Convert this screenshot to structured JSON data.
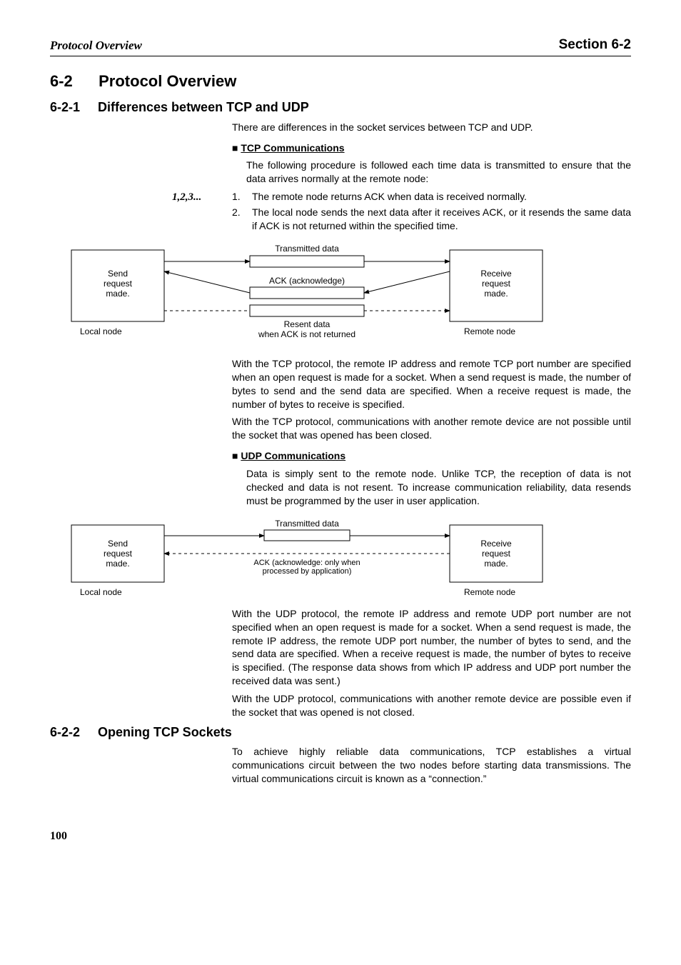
{
  "header": {
    "left": "Protocol Overview",
    "right": "Section 6-2"
  },
  "section": {
    "num": "6-2",
    "title": "Protocol Overview"
  },
  "sub1": {
    "num": "6-2-1",
    "title": "Differences between TCP and UDP",
    "intro": "There are differences in the socket services between TCP and UDP.",
    "tcp_h": "TCP Communications",
    "tcp_p1": "The following procedure is followed each time data is transmitted to ensure that the data arrives normally at the remote node:",
    "list_marker": "1,2,3...",
    "li1": "The remote node returns ACK when data is received normally.",
    "li2": "The local node sends the next data after it receives ACK, or it resends the same data if ACK is not returned within the specified time.",
    "tcp_p2": "With the TCP protocol, the remote IP address and remote TCP port number are specified when an open request is made for a socket. When a send request is made, the number of bytes to send and the send data are specified. When a receive request is made, the number of bytes to receive is specified.",
    "tcp_p3": "With the TCP protocol, communications with another remote device are not possible until the socket that was opened has been closed.",
    "udp_h": "UDP Communications",
    "udp_p1": "Data is simply sent to the remote node. Unlike TCP, the reception of data is not checked and data is not resent. To increase communication reliability, data resends must be programmed by the user in user application.",
    "udp_p2": "With the UDP protocol, the remote IP address and remote UDP port number are not specified when an open request is made for a socket. When a send request is made, the remote IP address, the remote UDP port number, the number of bytes to send, and the send data are specified. When a receive request is made, the number of bytes to receive is specified. (The response data shows from which IP address and UDP port number the received data was sent.)",
    "udp_p3": "With the UDP protocol, communications with another remote device are possible even if the socket that was opened is not closed."
  },
  "sub2": {
    "num": "6-2-2",
    "title": "Opening TCP Sockets",
    "p1": "To achieve highly reliable data communications, TCP establishes a virtual communications circuit between the two nodes before starting data transmissions. The virtual communications circuit is known as a “connection.”"
  },
  "diagram1": {
    "send1": "Send",
    "send2": "request",
    "send3": "made.",
    "local": "Local node",
    "trans": "Transmitted data",
    "ack": "ACK (acknowledge)",
    "resent1": "Resent data",
    "resent2": "when ACK is not returned",
    "recv1": "Receive",
    "recv2": "request",
    "recv3": "made.",
    "remote": "Remote node"
  },
  "diagram2": {
    "send1": "Send",
    "send2": "request",
    "send3": "made.",
    "local": "Local node",
    "trans": "Transmitted data",
    "ack1": "ACK (acknowledge: only when",
    "ack2": "processed by application)",
    "recv1": "Receive",
    "recv2": "request",
    "recv3": "made.",
    "remote": "Remote node"
  },
  "page": "100"
}
